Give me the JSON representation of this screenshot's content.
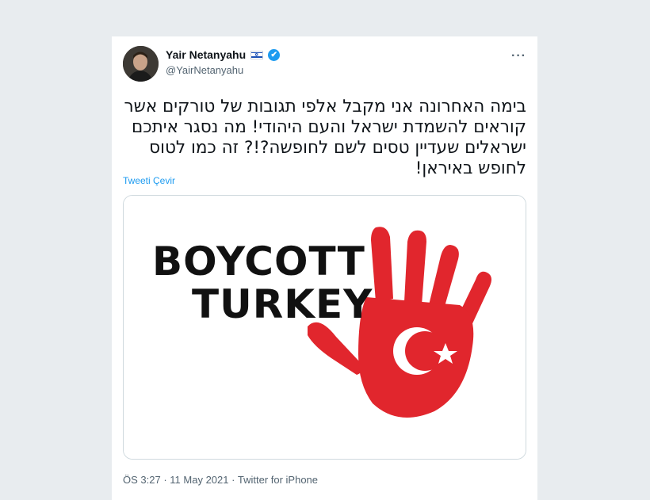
{
  "tweet": {
    "display_name": "Yair Netanyahu",
    "handle": "@YairNetanyahu",
    "text": "בימה האחרונה אני מקבל אלפי תגובות של טורקים אשר קוראים להשמדת ישראל והעם היהודי! מה נסגר איתכם ישראלים שעדיין טסים לשם לחופשה?!? זה כמו לטוס לחופש באיראן!",
    "translate_label": "Tweeti Çevir",
    "time": "ÖS 3:27",
    "date": "11 May 2021",
    "source": "Twitter for iPhone",
    "separator": "·",
    "more_label": "···"
  },
  "media": {
    "line1": "BOYCOTT",
    "line2": "TURKEY",
    "hand_color": "#e1262d"
  },
  "icons": {
    "verified": "verified-badge-icon",
    "flag": "israel-flag-icon",
    "more": "more-options-icon"
  },
  "colors": {
    "accent": "#1d9bf0",
    "secondary_text": "#536471",
    "primary_text": "#0f1419"
  }
}
